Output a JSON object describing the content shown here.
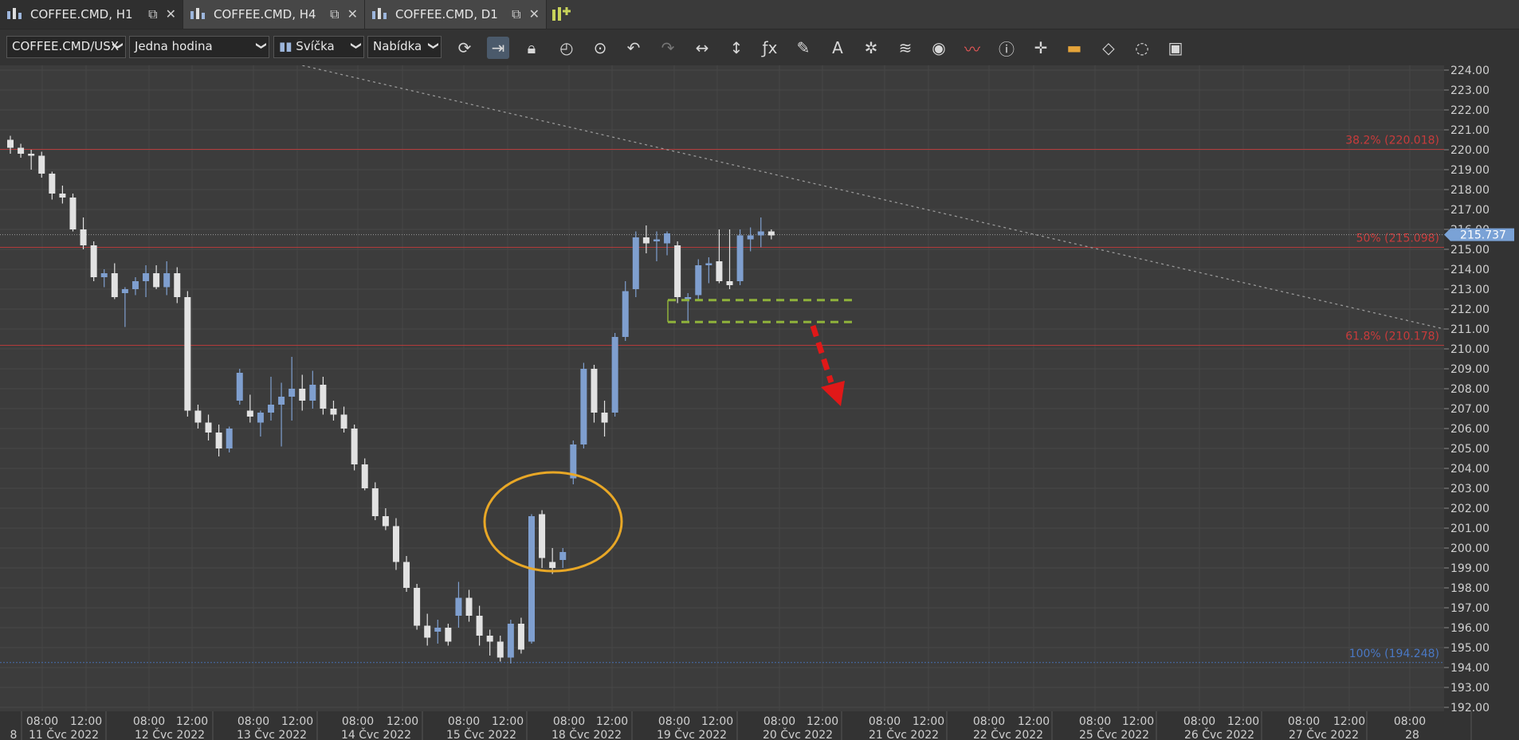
{
  "tabs": [
    {
      "label": "COFFEE.CMD, H1",
      "active": true
    },
    {
      "label": "COFFEE.CMD, H4",
      "active": false
    },
    {
      "label": "COFFEE.CMD, D1",
      "active": false
    }
  ],
  "toolbar": {
    "instrument": "COFFEE.CMD/USX",
    "period": "Jedna hodina",
    "chart_type": "Svíčka",
    "price_side": "Nabídka",
    "icons": [
      "refresh-icon",
      "shift-chart-icon",
      "lock-icon",
      "zoom-time-icon",
      "zoom-fit-icon",
      "undo-icon",
      "redo-icon",
      "horizontal-resize-icon",
      "vertical-resize-icon",
      "indicators-fx-icon",
      "pencil-icon",
      "text-tool-icon",
      "pattern-icon",
      "layers-icon",
      "eye-icon",
      "trend-icon",
      "info-icon",
      "crosshair-icon",
      "color-bar-icon",
      "paint-bucket-icon",
      "settings-cycle-icon",
      "save-icon"
    ]
  },
  "chart_data": {
    "type": "candlestick",
    "y_axis": {
      "min": 192.0,
      "max": 224.0,
      "step": 1.0,
      "labels": [
        "224.00",
        "223.00",
        "222.00",
        "221.00",
        "220.00",
        "219.00",
        "218.00",
        "217.00",
        "216.00",
        "215.00",
        "214.00",
        "213.00",
        "212.00",
        "211.00",
        "210.00",
        "209.00",
        "208.00",
        "207.00",
        "206.00",
        "205.00",
        "204.00",
        "203.00",
        "202.00",
        "201.00",
        "200.00",
        "199.00",
        "198.00",
        "197.00",
        "196.00",
        "195.00",
        "194.00",
        "193.00",
        "192.00"
      ]
    },
    "current_price": "215.737",
    "fib_levels": [
      {
        "label": "38.2% (220.018)",
        "value": 220.018,
        "color": "#c93b3b"
      },
      {
        "label": "50% (215.098)",
        "value": 215.098,
        "color": "#c93b3b"
      },
      {
        "label": "61.8% (210.178)",
        "value": 210.178,
        "color": "#c93b3b"
      },
      {
        "label": "100% (194.248)",
        "value": 194.248,
        "color": "#4a78c4"
      }
    ],
    "x_time_labels": [
      "08:00",
      "12:00",
      "08:00",
      "12:00",
      "08:00",
      "12:00",
      "08:00",
      "12:00",
      "08:00",
      "12:00",
      "08:00",
      "12:00",
      "08:00",
      "12:00",
      "08:00",
      "12:00",
      "08:00",
      "12:00",
      "08:00",
      "12:00",
      "08:00",
      "12:00",
      "08:00",
      "12:00",
      "08:00",
      "12:00",
      "08:00"
    ],
    "x_date_labels": [
      "8",
      "11 Čvc 2022",
      "12 Čvc 2022",
      "13 Čvc 2022",
      "14 Čvc 2022",
      "15 Čvc 2022",
      "18 Čvc 2022",
      "19 Čvc 2022",
      "20 Čvc 2022",
      "21 Čvc 2022",
      "22 Čvc 2022",
      "25 Čvc 2022",
      "26 Čvc 2022",
      "27 Čvc 2022",
      "28"
    ],
    "candles": [
      [
        220.5,
        220.7,
        219.8,
        220.1
      ],
      [
        220.1,
        220.3,
        219.6,
        219.8
      ],
      [
        219.8,
        220.0,
        219.0,
        219.7
      ],
      [
        219.7,
        219.9,
        218.6,
        218.8
      ],
      [
        218.8,
        218.9,
        217.5,
        217.8
      ],
      [
        217.8,
        218.2,
        217.3,
        217.6
      ],
      [
        217.6,
        217.8,
        215.9,
        216.0
      ],
      [
        216.0,
        216.6,
        215.0,
        215.2
      ],
      [
        215.2,
        215.4,
        213.4,
        213.6
      ],
      [
        213.6,
        214.0,
        213.1,
        213.8
      ],
      [
        213.8,
        214.3,
        212.5,
        212.6
      ],
      [
        212.8,
        213.1,
        211.1,
        213.0
      ],
      [
        213.0,
        213.6,
        212.7,
        213.4
      ],
      [
        213.4,
        214.2,
        212.6,
        213.8
      ],
      [
        213.8,
        214.2,
        213.0,
        213.1
      ],
      [
        213.1,
        214.4,
        212.7,
        213.8
      ],
      [
        213.8,
        214.1,
        212.3,
        212.6
      ],
      [
        212.6,
        212.9,
        206.6,
        206.9
      ],
      [
        206.9,
        207.2,
        206.0,
        206.3
      ],
      [
        206.3,
        206.7,
        205.4,
        205.8
      ],
      [
        205.8,
        206.2,
        204.6,
        205.0
      ],
      [
        205.0,
        206.1,
        204.8,
        206.0
      ],
      [
        207.4,
        209.0,
        207.2,
        208.8
      ],
      [
        206.9,
        207.7,
        206.3,
        206.6
      ],
      [
        206.3,
        206.9,
        205.6,
        206.8
      ],
      [
        206.8,
        208.6,
        206.4,
        207.2
      ],
      [
        207.2,
        208.3,
        205.1,
        207.6
      ],
      [
        207.6,
        209.6,
        206.4,
        208.0
      ],
      [
        208.0,
        208.7,
        206.9,
        207.4
      ],
      [
        207.4,
        208.9,
        207.0,
        208.2
      ],
      [
        208.2,
        208.6,
        206.7,
        207.0
      ],
      [
        207.0,
        207.4,
        206.4,
        206.7
      ],
      [
        206.7,
        207.1,
        205.8,
        206.0
      ],
      [
        206.0,
        206.2,
        203.9,
        204.2
      ],
      [
        204.2,
        204.5,
        202.9,
        203.0
      ],
      [
        203.0,
        203.3,
        201.4,
        201.6
      ],
      [
        201.6,
        202.0,
        200.9,
        201.1
      ],
      [
        201.1,
        201.5,
        198.9,
        199.3
      ],
      [
        199.3,
        199.6,
        197.8,
        198.0
      ],
      [
        198.0,
        198.2,
        195.9,
        196.1
      ],
      [
        196.1,
        196.7,
        195.1,
        195.5
      ],
      [
        195.8,
        196.4,
        195.2,
        196.0
      ],
      [
        196.0,
        196.2,
        195.1,
        195.3
      ],
      [
        196.6,
        198.3,
        196.0,
        197.5
      ],
      [
        197.5,
        197.9,
        196.3,
        196.6
      ],
      [
        196.6,
        197.1,
        195.1,
        195.6
      ],
      [
        195.6,
        195.9,
        194.6,
        195.3
      ],
      [
        195.3,
        195.6,
        194.3,
        194.5
      ],
      [
        194.5,
        196.4,
        194.2,
        196.2
      ],
      [
        196.2,
        196.5,
        194.7,
        194.9
      ],
      [
        195.3,
        201.7,
        195.2,
        201.6
      ],
      [
        201.7,
        201.9,
        199.0,
        199.5
      ],
      [
        199.3,
        200.0,
        198.7,
        199.0
      ],
      [
        199.4,
        200.0,
        199.0,
        199.8
      ],
      [
        203.5,
        205.4,
        203.2,
        205.2
      ],
      [
        205.2,
        209.3,
        205.0,
        209.0
      ],
      [
        209.0,
        209.2,
        206.3,
        206.8
      ],
      [
        206.8,
        207.4,
        205.6,
        206.3
      ],
      [
        206.8,
        210.8,
        206.6,
        210.6
      ],
      [
        210.6,
        213.4,
        210.4,
        212.9
      ],
      [
        213.0,
        215.9,
        212.6,
        215.6
      ],
      [
        215.6,
        216.2,
        214.8,
        215.3
      ],
      [
        215.4,
        215.9,
        214.4,
        215.5
      ],
      [
        215.3,
        215.9,
        214.7,
        215.8
      ],
      [
        215.2,
        215.4,
        212.3,
        212.6
      ],
      [
        212.5,
        212.8,
        211.3,
        212.6
      ],
      [
        212.7,
        214.5,
        212.4,
        214.2
      ],
      [
        214.2,
        214.6,
        213.3,
        214.3
      ],
      [
        214.4,
        216.0,
        213.3,
        213.4
      ],
      [
        213.4,
        216.0,
        213.0,
        213.2
      ],
      [
        213.4,
        216.0,
        213.2,
        215.7
      ],
      [
        215.5,
        216.1,
        214.9,
        215.7
      ],
      [
        215.7,
        216.6,
        215.1,
        215.9
      ],
      [
        215.9,
        216.0,
        215.5,
        215.7
      ]
    ]
  }
}
